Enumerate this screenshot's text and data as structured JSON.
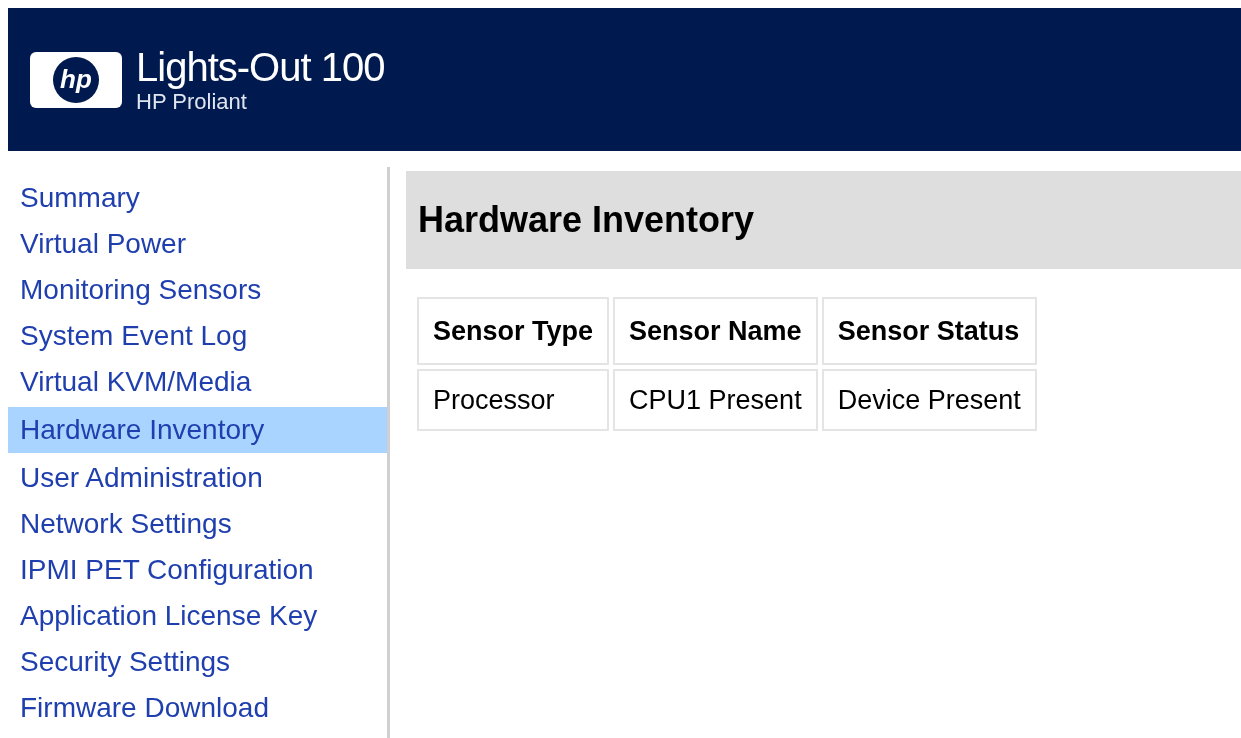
{
  "header": {
    "logo_text": "hp",
    "title": "Lights-Out 100",
    "subtitle": "HP Proliant"
  },
  "sidebar": {
    "items": [
      {
        "label": "Summary",
        "selected": false
      },
      {
        "label": "Virtual Power",
        "selected": false
      },
      {
        "label": "Monitoring Sensors",
        "selected": false
      },
      {
        "label": "System Event Log",
        "selected": false
      },
      {
        "label": "Virtual KVM/Media",
        "selected": false
      },
      {
        "label": "Hardware Inventory",
        "selected": true
      },
      {
        "label": "User Administration",
        "selected": false
      },
      {
        "label": "Network Settings",
        "selected": false
      },
      {
        "label": "IPMI PET Configuration",
        "selected": false
      },
      {
        "label": "Application License Key",
        "selected": false
      },
      {
        "label": "Security Settings",
        "selected": false
      },
      {
        "label": "Firmware Download",
        "selected": false
      }
    ]
  },
  "page_title": "Hardware Inventory",
  "table": {
    "columns": [
      "Sensor Type",
      "Sensor Name",
      "Sensor Status"
    ],
    "rows": [
      [
        "Processor",
        "CPU1 Present",
        "Device Present"
      ]
    ]
  }
}
